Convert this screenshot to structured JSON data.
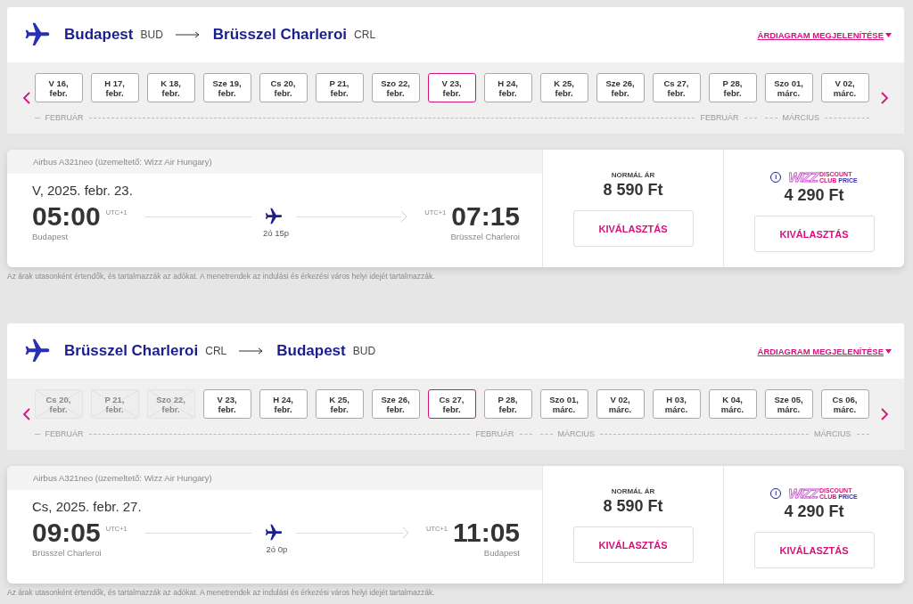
{
  "legs": [
    {
      "route": {
        "from_city": "Budapest",
        "from_code": "BUD",
        "to_city": "Brüsszel Charleroi",
        "to_code": "CRL"
      },
      "chart_link": "ÁRDIAGRAM MEGJELENÍTÉSE",
      "months": [
        {
          "start_label": "FEBRUÁR",
          "end_label": "FEBRUÁR",
          "dates": [
            {
              "day": "V 16,",
              "month": "febr.",
              "selected": false,
              "disabled": false
            },
            {
              "day": "H 17,",
              "month": "febr.",
              "selected": false,
              "disabled": false
            },
            {
              "day": "K 18,",
              "month": "febr.",
              "selected": false,
              "disabled": false
            },
            {
              "day": "Sze 19,",
              "month": "febr.",
              "selected": false,
              "disabled": false
            },
            {
              "day": "Cs 20,",
              "month": "febr.",
              "selected": false,
              "disabled": false
            },
            {
              "day": "P 21,",
              "month": "febr.",
              "selected": false,
              "disabled": false
            },
            {
              "day": "Szo 22,",
              "month": "febr.",
              "selected": false,
              "disabled": false
            },
            {
              "day": "V 23,",
              "month": "febr.",
              "selected": true,
              "disabled": false
            },
            {
              "day": "H 24,",
              "month": "febr.",
              "selected": false,
              "disabled": false
            },
            {
              "day": "K 25,",
              "month": "febr.",
              "selected": false,
              "disabled": false
            },
            {
              "day": "Sze 26,",
              "month": "febr.",
              "selected": false,
              "disabled": false
            },
            {
              "day": "Cs 27,",
              "month": "febr.",
              "selected": false,
              "disabled": false
            },
            {
              "day": "P 28,",
              "month": "febr.",
              "selected": false,
              "disabled": false
            }
          ]
        },
        {
          "start_label": "MÁRCIUS",
          "dates": [
            {
              "day": "Szo 01,",
              "month": "márc.",
              "selected": false,
              "disabled": false
            },
            {
              "day": "V 02,",
              "month": "márc.",
              "selected": false,
              "disabled": false
            }
          ]
        }
      ],
      "flight": {
        "aircraft": "Airbus A321neo (üzemeltető: Wizz Air Hungary)",
        "date": "V, 2025. febr. 23.",
        "dep_time": "05:00",
        "dep_tz": "UTC+1",
        "dep_city": "Budapest",
        "duration": "2ó 15p",
        "arr_tz": "UTC+1",
        "arr_time": "07:15",
        "arr_city": "Brüsszel Charleroi"
      },
      "normal_price": {
        "label": "NORMÁL ÁR",
        "price": "8 590 Ft",
        "button": "KIVÁLASZTÁS"
      },
      "club_price": {
        "info": "i",
        "brand": "WIZZ",
        "line1": "DISCOUNT",
        "line2a": "CLUB",
        "line2b": "PRICE",
        "price": "4 290 Ft",
        "button": "KIVÁLASZTÁS"
      },
      "note": "Az árak utasonként értendők, és tartalmazzák az adókat. A menetrendek az indulási és érkezési város helyi idejét tartalmazzák."
    },
    {
      "route": {
        "from_city": "Brüsszel Charleroi",
        "from_code": "CRL",
        "to_city": "Budapest",
        "to_code": "BUD"
      },
      "chart_link": "ÁRDIAGRAM MEGJELENÍTÉSE",
      "months": [
        {
          "start_label": "FEBRUÁR",
          "end_label": "FEBRUÁR",
          "dates": [
            {
              "day": "Cs 20,",
              "month": "febr.",
              "selected": false,
              "disabled": true
            },
            {
              "day": "P 21,",
              "month": "febr.",
              "selected": false,
              "disabled": true
            },
            {
              "day": "Szo 22,",
              "month": "febr.",
              "selected": false,
              "disabled": true
            },
            {
              "day": "V 23,",
              "month": "febr.",
              "selected": false,
              "disabled": false
            },
            {
              "day": "H 24,",
              "month": "febr.",
              "selected": false,
              "disabled": false
            },
            {
              "day": "K 25,",
              "month": "febr.",
              "selected": false,
              "disabled": false
            },
            {
              "day": "Sze 26,",
              "month": "febr.",
              "selected": false,
              "disabled": false
            },
            {
              "day": "Cs 27,",
              "month": "febr.",
              "selected": true,
              "disabled": false
            },
            {
              "day": "P 28,",
              "month": "febr.",
              "selected": false,
              "disabled": false
            }
          ]
        },
        {
          "start_label": "MÁRCIUS",
          "end_label": "MÁRCIUS",
          "dates": [
            {
              "day": "Szo 01,",
              "month": "márc.",
              "selected": false,
              "disabled": false
            },
            {
              "day": "V 02,",
              "month": "márc.",
              "selected": false,
              "disabled": false
            },
            {
              "day": "H 03,",
              "month": "márc.",
              "selected": false,
              "disabled": false
            },
            {
              "day": "K 04,",
              "month": "márc.",
              "selected": false,
              "disabled": false
            },
            {
              "day": "Sze 05,",
              "month": "márc.",
              "selected": false,
              "disabled": false
            },
            {
              "day": "Cs 06,",
              "month": "márc.",
              "selected": false,
              "disabled": false
            }
          ]
        }
      ],
      "flight": {
        "aircraft": "Airbus A321neo (üzemeltető: Wizz Air Hungary)",
        "date": "Cs, 2025. febr. 27.",
        "dep_time": "09:05",
        "dep_tz": "UTC+1",
        "dep_city": "Brüsszel Charleroi",
        "duration": "2ó 0p",
        "arr_tz": "UTC+1",
        "arr_time": "11:05",
        "arr_city": "Budapest"
      },
      "normal_price": {
        "label": "NORMÁL ÁR",
        "price": "8 590 Ft",
        "button": "KIVÁLASZTÁS"
      },
      "club_price": {
        "info": "i",
        "brand": "WIZZ",
        "line1": "DISCOUNT",
        "line2a": "CLUB",
        "line2b": "PRICE",
        "price": "4 290 Ft",
        "button": "KIVÁLASZTÁS"
      },
      "note": "Az árak utasonként értendők, és tartalmazzák az adókat. A menetrendek az indulási és érkezési város helyi idejét tartalmazzák."
    }
  ]
}
